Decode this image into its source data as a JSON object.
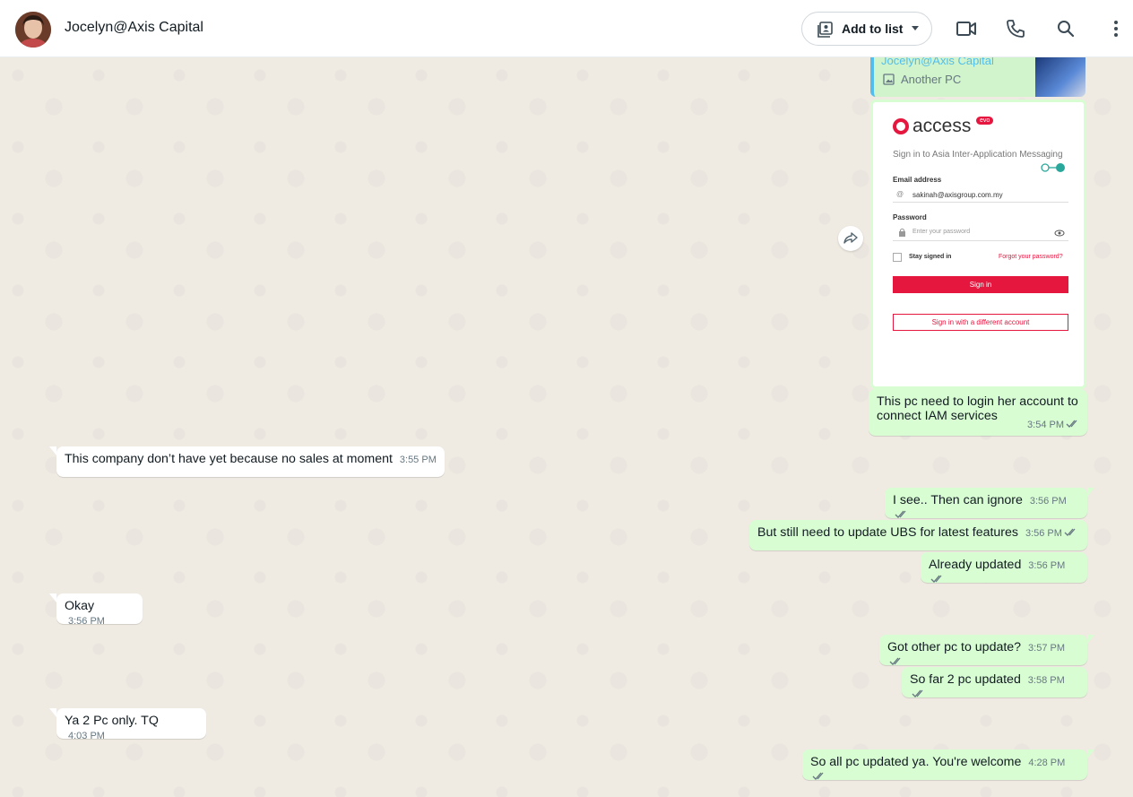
{
  "header": {
    "contact_name": "Jocelyn@Axis Capital",
    "add_to_list_label": "Add to list"
  },
  "quoted": {
    "name": "Jocelyn@Axis Capital",
    "text": "Another PC"
  },
  "screenshot": {
    "brand": "access",
    "badge": "evo",
    "heading": "Sign in to Asia Inter-Application Messaging",
    "email_label": "Email address",
    "email_value": "sakinah@axisgroup.com.my",
    "password_label": "Password",
    "password_placeholder": "Enter your password",
    "stay_signed_in": "Stay signed in",
    "forgot": "Forgot your password?",
    "sign_in": "Sign in",
    "sign_in_other": "Sign in with a different account"
  },
  "messages": [
    {
      "dir": "out",
      "text": "This pc need to login her account to connect IAM services",
      "time": "3:54 PM"
    },
    {
      "dir": "in",
      "text": "This company don’t have yet because no sales at moment",
      "time": "3:55 PM"
    },
    {
      "dir": "out",
      "text": "I see.. Then can ignore",
      "time": "3:56 PM"
    },
    {
      "dir": "out",
      "text": "But still need to update UBS for latest features",
      "time": "3:56 PM"
    },
    {
      "dir": "out",
      "text": "Already updated",
      "time": "3:56 PM"
    },
    {
      "dir": "in",
      "text": "Okay",
      "time": "3:56 PM"
    },
    {
      "dir": "out",
      "text": "Got other pc to update?",
      "time": "3:57 PM"
    },
    {
      "dir": "out",
      "text": "So far 2 pc updated",
      "time": "3:58 PM"
    },
    {
      "dir": "in",
      "text": "Ya 2 Pc only. TQ",
      "time": "4:03 PM"
    },
    {
      "dir": "out",
      "text": "So all pc updated ya. You're welcome",
      "time": "4:28 PM"
    }
  ],
  "colors": {
    "outgoing_bubble": "#d9fdd3",
    "incoming_bubble": "#ffffff",
    "chat_background": "#efeae2",
    "read_ticks": "#667781",
    "quote_accent": "#53bdeb"
  }
}
